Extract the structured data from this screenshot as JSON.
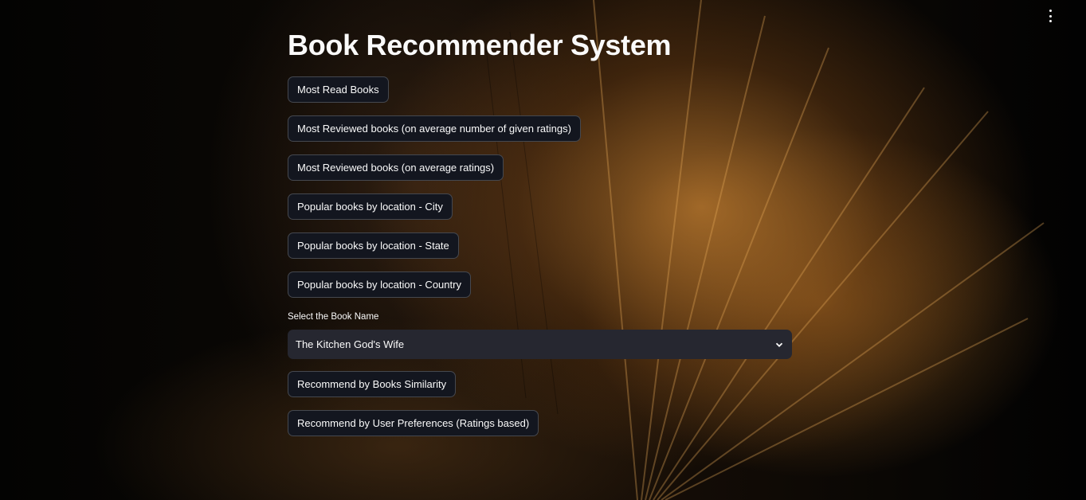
{
  "title": "Book Recommender System",
  "buttons": {
    "most_read": "Most Read Books",
    "most_reviewed_count": "Most Reviewed books (on average number of given ratings)",
    "most_reviewed_avg": "Most Reviewed books (on average ratings)",
    "by_city": "Popular books by location - City",
    "by_state": "Popular books by location - State",
    "by_country": "Popular books by location - Country",
    "recommend_similarity": "Recommend by Books Similarity",
    "recommend_user": "Recommend by User Preferences (Ratings based)"
  },
  "book_select": {
    "label": "Select the Book Name",
    "value": "The Kitchen God's Wife",
    "icon": "chevron-down-icon"
  },
  "menu_icon": "vertical-ellipsis-icon"
}
